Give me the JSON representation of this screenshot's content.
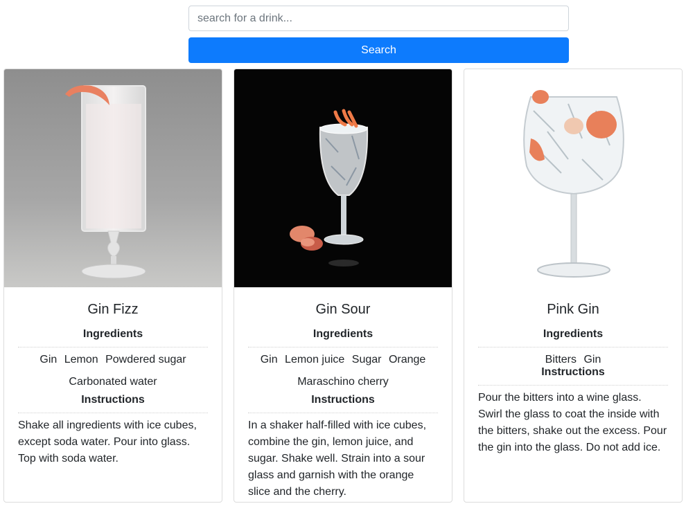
{
  "search": {
    "placeholder": "search for a drink...",
    "value": "",
    "button_label": "Search"
  },
  "drinks": [
    {
      "name": "Gin Fizz",
      "ingredients_heading": "Ingredients",
      "ingredients": [
        "Gin",
        "Lemon",
        "Powdered sugar",
        "Carbonated water"
      ],
      "instructions_heading": "Instructions",
      "instructions": "Shake all ingredients with ice cubes, except soda water. Pour into glass. Top with soda water."
    },
    {
      "name": "Gin Sour",
      "ingredients_heading": "Ingredients",
      "ingredients": [
        "Gin",
        "Lemon juice",
        "Sugar",
        "Orange",
        "Maraschino cherry"
      ],
      "instructions_heading": "Instructions",
      "instructions": "In a shaker half-filled with ice cubes, combine the gin, lemon juice, and sugar. Shake well. Strain into a sour glass and garnish with the orange slice and the cherry."
    },
    {
      "name": "Pink Gin",
      "ingredients_heading": "Ingredients",
      "ingredients": [
        "Bitters",
        "Gin"
      ],
      "instructions_heading": "Instructions",
      "instructions": "Pour the bitters into a wine glass. Swirl the glass to coat the inside with the bitters, shake out the excess. Pour the gin into the glass. Do not add ice."
    }
  ],
  "colors": {
    "accent": "#0d7bfd",
    "card_border": "#dcdcdc"
  }
}
